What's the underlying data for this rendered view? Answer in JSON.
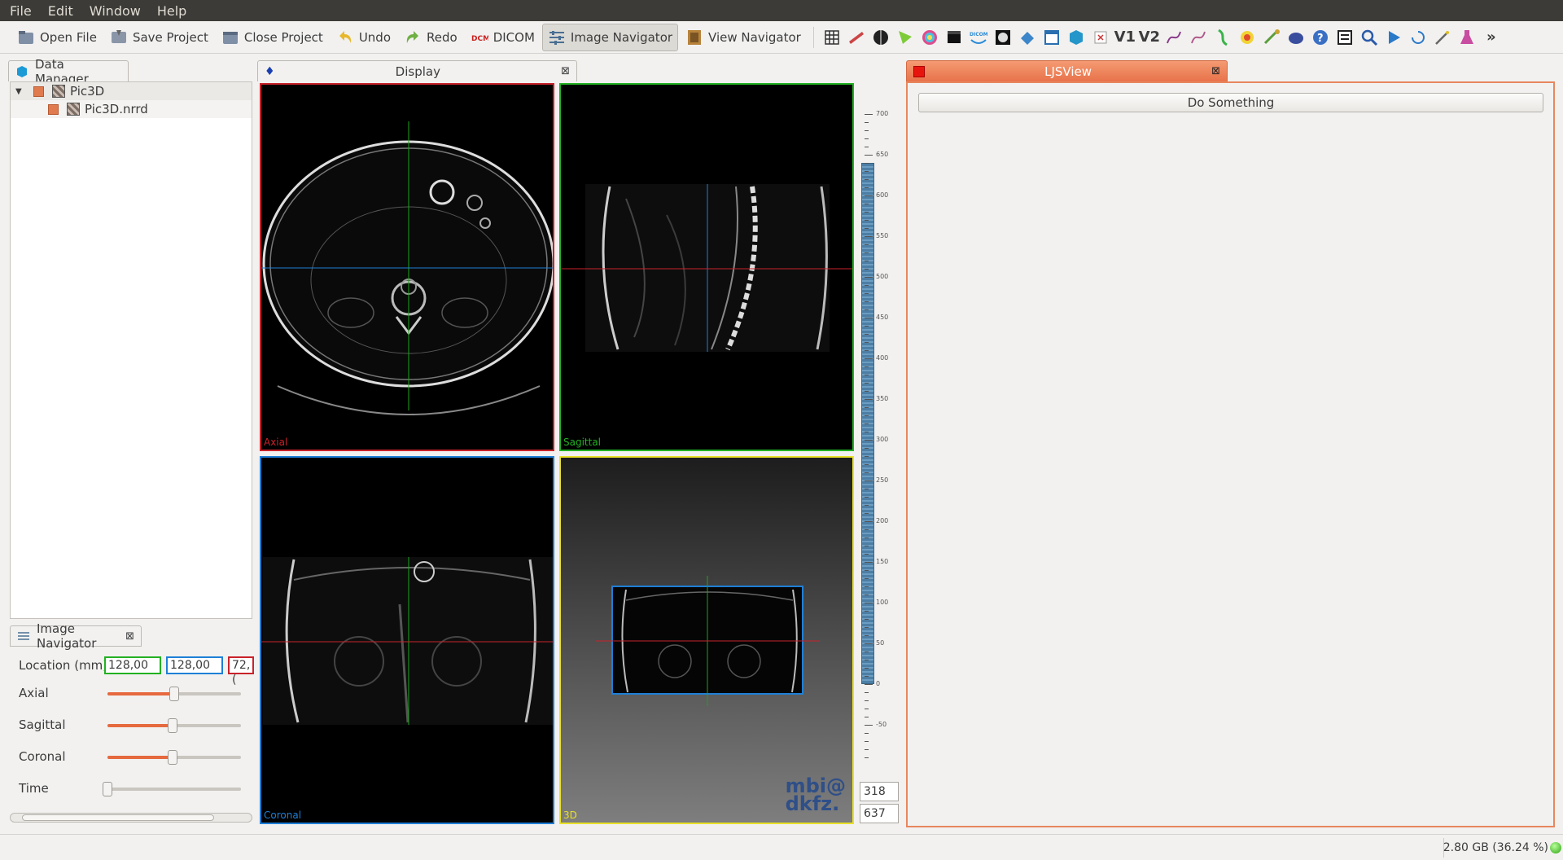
{
  "menu": [
    "File",
    "Edit",
    "Window",
    "Help"
  ],
  "toolbar": {
    "open_file": "Open File",
    "save_project": "Save Project",
    "close_project": "Close Project",
    "undo": "Undo",
    "redo": "Redo",
    "dicom": "DICOM",
    "image_navigator": "Image Navigator",
    "view_navigator": "View Navigator",
    "v1": "V1",
    "v2": "V2",
    "overflow": "»"
  },
  "data_manager": {
    "title": "Data Manager",
    "nodes": [
      {
        "label": "Pic3D",
        "expanded": true
      },
      {
        "label": "Pic3D.nrrd"
      }
    ]
  },
  "image_navigator_panel": {
    "title": "Image Navigator",
    "location_label": "Location (mm)",
    "location_values": [
      "128,00",
      "128,00",
      "72,("
    ],
    "axial_label": "Axial",
    "axial_value": 0.5,
    "sagittal_label": "Sagittal",
    "sagittal_value": 0.49,
    "coronal_label": "Coronal",
    "coronal_value": 0.49,
    "time_label": "Time",
    "time_value": 0.0
  },
  "display": {
    "title": "Display",
    "views": {
      "axial": "Axial",
      "sagittal": "Sagittal",
      "coronal": "Coronal",
      "three_d": "3D"
    },
    "watermark_lines": [
      "mbi@",
      "dkfz."
    ],
    "level_window": {
      "ticks": [
        "700",
        "650",
        "600",
        "550",
        "500",
        "450",
        "400",
        "350",
        "300",
        "250",
        "200",
        "150",
        "100",
        "50",
        "0",
        "-50"
      ],
      "value_upper": "318",
      "value_lower": "637"
    }
  },
  "ljsview": {
    "title": "LJSView",
    "button": "Do Something"
  },
  "status": {
    "memory": "2.80 GB (36.24 %)"
  },
  "colors": {
    "axial_border": "#c8222a",
    "sagittal_border": "#23b123",
    "coronal_border": "#1f7fd6",
    "three_d_border": "#e8e12a",
    "accent": "#e66a3e"
  }
}
